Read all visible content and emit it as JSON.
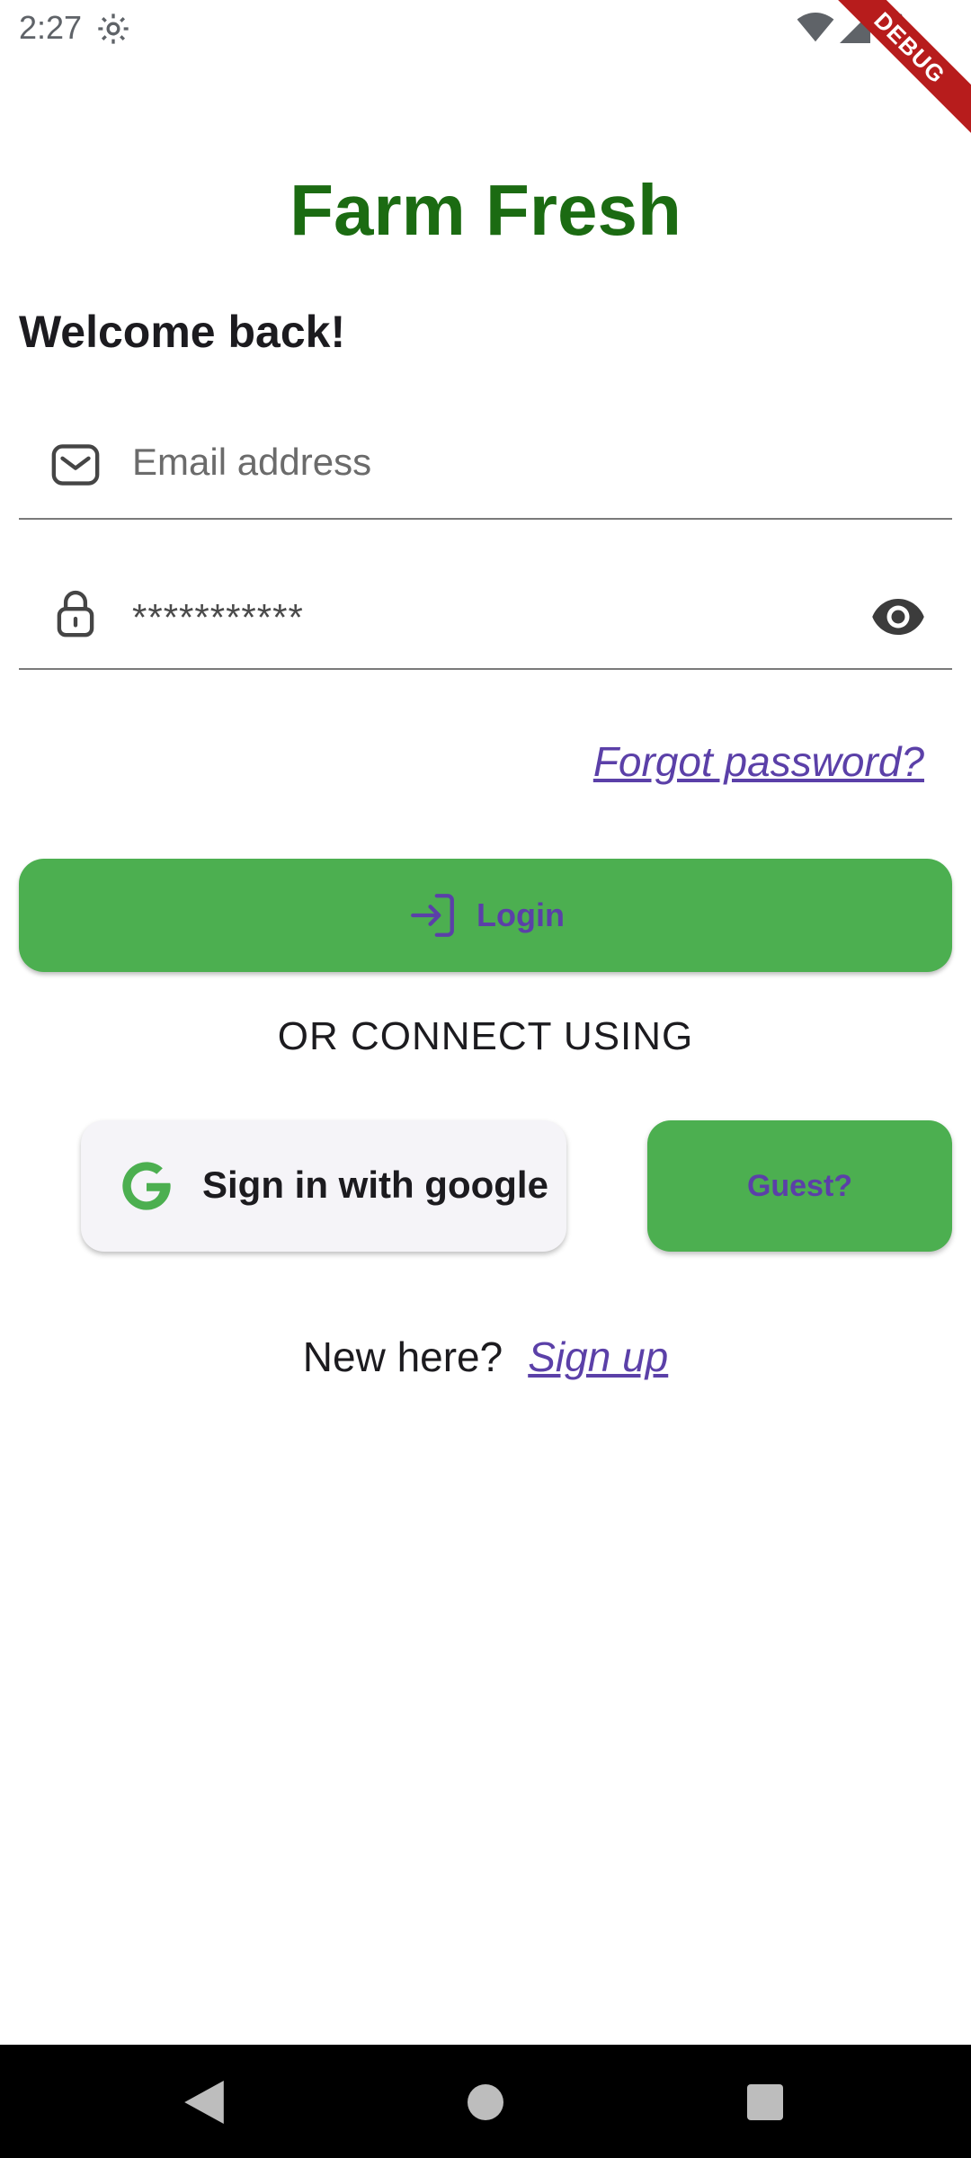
{
  "status_bar": {
    "time": "2:27",
    "debug_label": "DEBUG"
  },
  "app": {
    "title": "Farm Fresh",
    "welcome": "Welcome back!"
  },
  "form": {
    "email_placeholder": "Email address",
    "password_value": "***********",
    "forgot_label": "Forgot password?",
    "login_label": "Login"
  },
  "alternatives": {
    "or_text": "OR CONNECT USING",
    "google_label": "Sign in with google",
    "guest_label": "Guest?"
  },
  "signup": {
    "prompt": "New here?",
    "link_label": "Sign up"
  },
  "icons": {
    "email": "mail-icon",
    "password": "lock-icon",
    "visibility": "eye-icon",
    "login": "login-arrow-icon",
    "google": "google-g-icon"
  },
  "colors": {
    "title": "#1b6b12",
    "primary_button": "#4caf50",
    "link": "#5b40a8"
  }
}
